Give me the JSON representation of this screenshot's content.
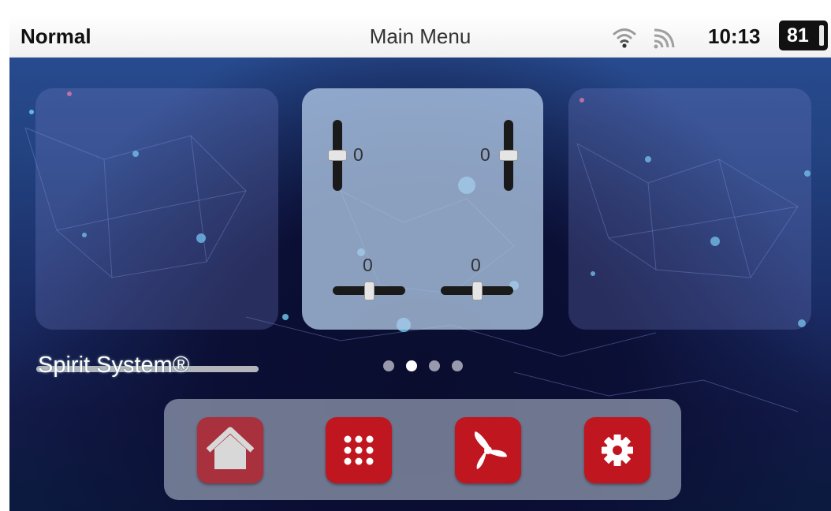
{
  "status_bar": {
    "mode": "Normal",
    "title": "Main Menu",
    "time": "10:13",
    "battery": "81",
    "icons": [
      "wifi-icon",
      "signal-icon"
    ]
  },
  "control_panel": {
    "sliders": [
      {
        "orientation": "vertical",
        "value": "0"
      },
      {
        "orientation": "vertical",
        "value": "0"
      },
      {
        "orientation": "horizontal",
        "value": "0"
      },
      {
        "orientation": "horizontal",
        "value": "0"
      }
    ]
  },
  "brand": "Spirit System®",
  "pager": {
    "count": 4,
    "active_index": 1
  },
  "dock": {
    "buttons": [
      {
        "icon": "home-icon"
      },
      {
        "icon": "grid-icon"
      },
      {
        "icon": "fan-icon"
      },
      {
        "icon": "gear-icon"
      }
    ]
  },
  "colors": {
    "accent": "#c0161f",
    "home_active": "#a9303d",
    "status_bar": "#f4f4f4"
  }
}
